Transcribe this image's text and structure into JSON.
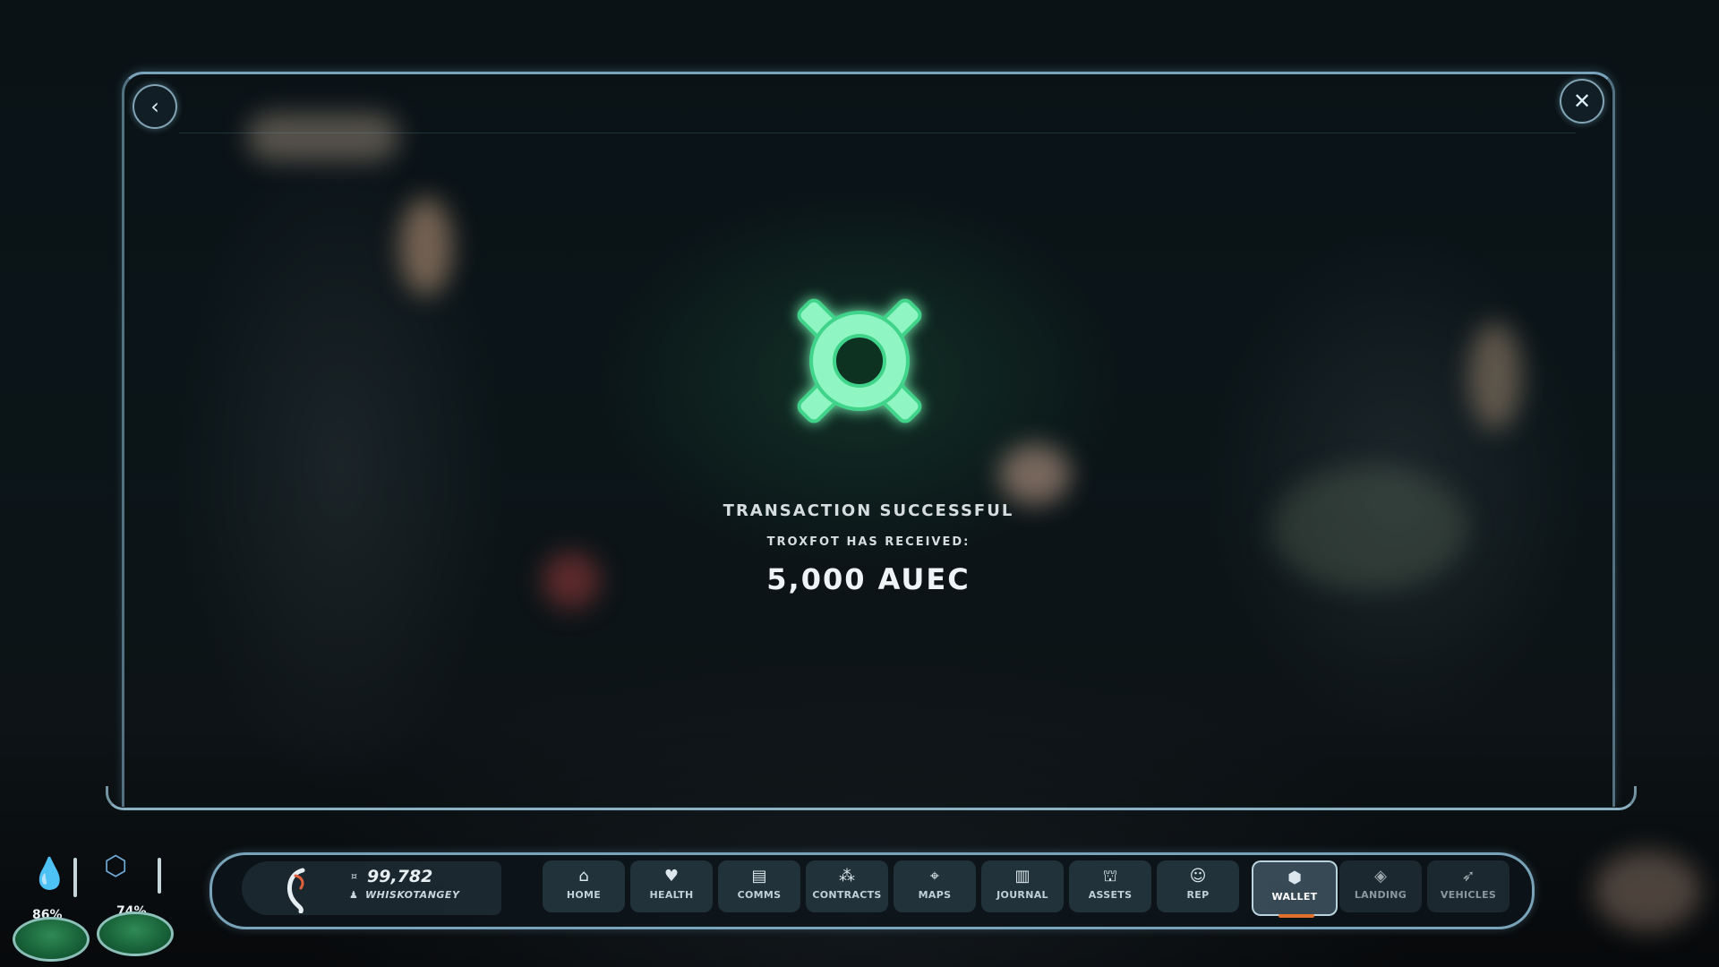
{
  "transaction": {
    "title": "TRANSACTION SUCCESSFUL",
    "recipient_line": "TROXFOT HAS RECEIVED:",
    "amount": "5,000 AUEC",
    "icon": "auec-currency-icon",
    "icon_color": "#5ff0a0"
  },
  "panel": {
    "back_icon": "chevron-left-icon",
    "close_icon": "close-icon"
  },
  "user": {
    "balance": "99,782",
    "username": "WHISKOTANGEY"
  },
  "nav": {
    "tabs": [
      {
        "label": "HOME",
        "icon": "home-icon"
      },
      {
        "label": "HEALTH",
        "icon": "heart-icon"
      },
      {
        "label": "COMMS",
        "icon": "chat-icon"
      },
      {
        "label": "CONTRACTS",
        "icon": "contracts-icon"
      },
      {
        "label": "MAPS",
        "icon": "map-icon"
      },
      {
        "label": "JOURNAL",
        "icon": "journal-icon"
      },
      {
        "label": "ASSETS",
        "icon": "assets-icon"
      },
      {
        "label": "REP",
        "icon": "rep-icon"
      },
      {
        "label": "WALLET",
        "icon": "wallet-icon",
        "active": true
      },
      {
        "label": "LANDING",
        "icon": "landing-icon"
      },
      {
        "label": "VEHICLES",
        "icon": "vehicles-icon"
      }
    ],
    "active_color": "#e0702a"
  },
  "vitals": {
    "hydration": {
      "label": "86%",
      "value": 0.86,
      "icon": "water-drop-icon"
    },
    "nutrition": {
      "label": "74%",
      "value": 0.74,
      "icon": "nutrition-icon"
    }
  }
}
